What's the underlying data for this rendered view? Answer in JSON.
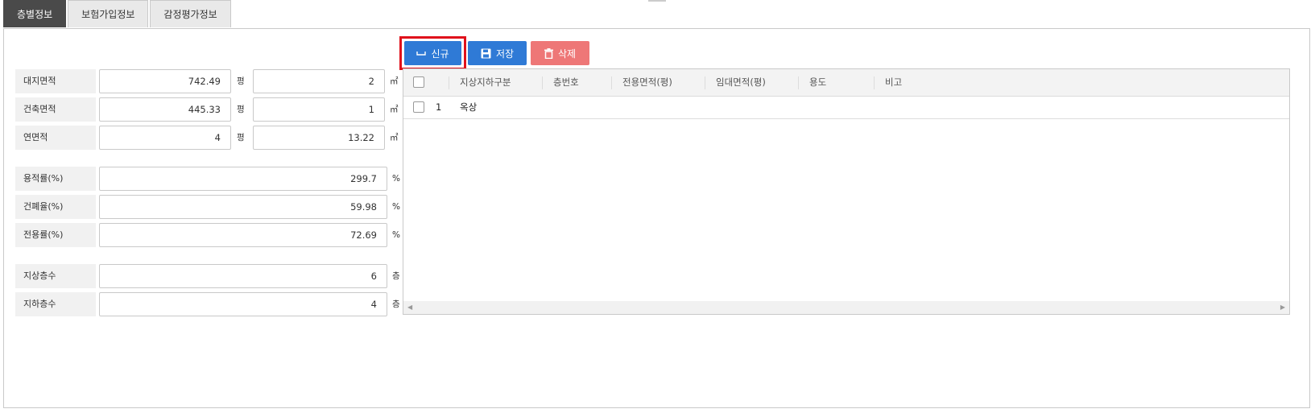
{
  "tabs": [
    {
      "label": "층별정보",
      "active": true
    },
    {
      "label": "보험가입정보",
      "active": false
    },
    {
      "label": "감정평가정보",
      "active": false
    }
  ],
  "toolbar": {
    "new_label": "신규",
    "save_label": "저장",
    "delete_label": "삭제"
  },
  "form": {
    "land_area": {
      "label": "대지면적",
      "pyeong": "742.49",
      "pyeong_unit": "평",
      "sqm": "2",
      "sqm_unit": "㎡"
    },
    "building_area": {
      "label": "건축면적",
      "pyeong": "445.33",
      "pyeong_unit": "평",
      "sqm": "1",
      "sqm_unit": "㎡"
    },
    "total_floor_area": {
      "label": "연면적",
      "pyeong": "4",
      "pyeong_unit": "평",
      "sqm": "13.22",
      "sqm_unit": "㎡"
    },
    "floor_area_ratio": {
      "label": "용적률(%)",
      "value": "299.7",
      "unit": "%"
    },
    "coverage_ratio": {
      "label": "건폐율(%)",
      "value": "59.98",
      "unit": "%"
    },
    "exclusive_ratio": {
      "label": "전용률(%)",
      "value": "72.69",
      "unit": "%"
    },
    "above_floors": {
      "label": "지상층수",
      "value": "6",
      "unit": "층"
    },
    "below_floors": {
      "label": "지하층수",
      "value": "4",
      "unit": "층"
    }
  },
  "grid": {
    "columns": [
      "지상지하구분",
      "층번호",
      "전용면적(평)",
      "임대면적(평)",
      "용도",
      "비고"
    ],
    "rows": [
      {
        "no": "1",
        "type": "옥상",
        "floor": "",
        "exclusive": "",
        "lease": "",
        "use": "",
        "note": ""
      }
    ]
  },
  "colors": {
    "primary": "#2f7ad6",
    "danger": "#ee7777",
    "highlight": "#e0111b",
    "tab_active": "#4a4a4a"
  }
}
